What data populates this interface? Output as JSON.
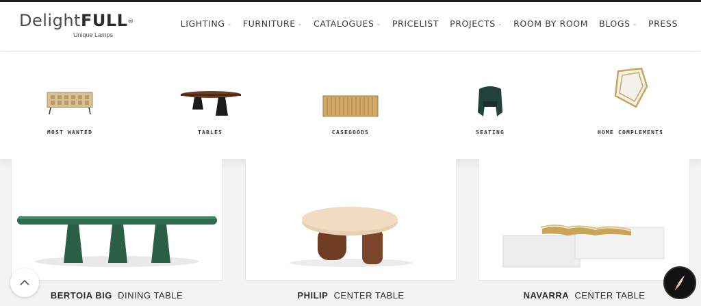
{
  "brand": {
    "name_light": "Delight",
    "name_bold": "FULL",
    "reg_mark": "®",
    "tagline": "Unique Lamps"
  },
  "nav": [
    {
      "label": "LIGHTING",
      "has_dropdown": true
    },
    {
      "label": "FURNITURE",
      "has_dropdown": true
    },
    {
      "label": "CATALOGUES",
      "has_dropdown": true
    },
    {
      "label": "PRICELIST",
      "has_dropdown": false
    },
    {
      "label": "PROJECTS",
      "has_dropdown": true
    },
    {
      "label": "ROOM BY ROOM",
      "has_dropdown": false
    },
    {
      "label": "BLOGS",
      "has_dropdown": true
    },
    {
      "label": "PRESS",
      "has_dropdown": false
    }
  ],
  "mega_menu": [
    {
      "label": "MOST WANTED",
      "icon": "sideboard-icon"
    },
    {
      "label": "TABLES",
      "icon": "dining-table-icon"
    },
    {
      "label": "CASEGOODS",
      "icon": "console-icon"
    },
    {
      "label": "SEATING",
      "icon": "armchair-icon"
    },
    {
      "label": "HOME COMPLEMENTS",
      "icon": "mirror-icon"
    }
  ],
  "products": [
    {
      "name": "BERTOIA BIG",
      "type": "DINING TABLE"
    },
    {
      "name": "PHILIP",
      "type": "CENTER TABLE"
    },
    {
      "name": "NAVARRA",
      "type": "CENTER TABLE"
    }
  ],
  "colors": {
    "accent": "#c9a55a",
    "green_marble": "#2e6b4f",
    "white_marble": "#ececec",
    "wood_light": "#e8cfb1",
    "wood_dark": "#6e3d23"
  }
}
